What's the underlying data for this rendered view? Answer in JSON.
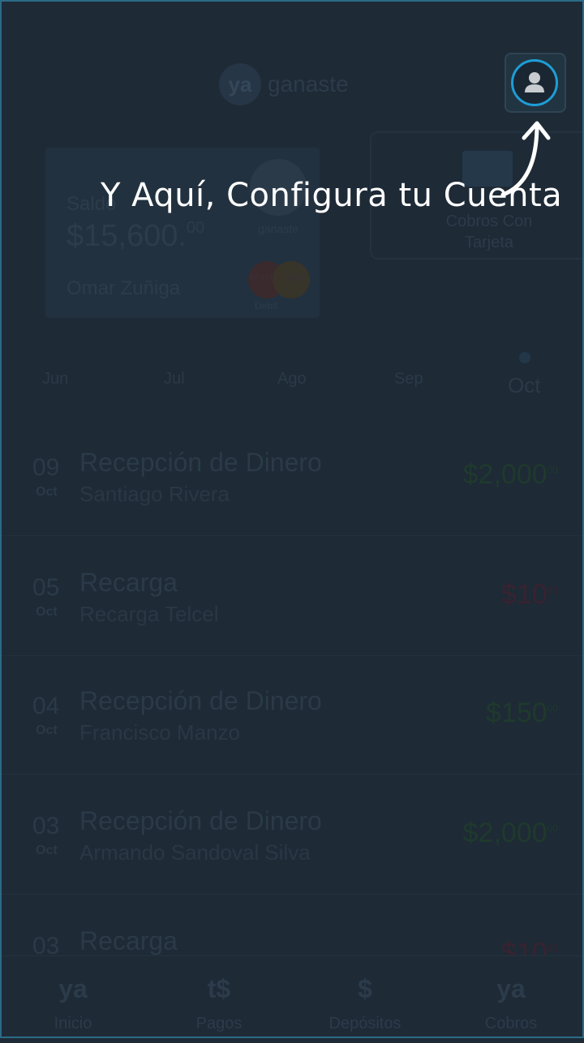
{
  "header": {
    "logo_badge": "ya",
    "logo_text": "ganaste"
  },
  "account_card": {
    "saldo_label": "Saldo",
    "amount": "$15,600.",
    "cents": "00",
    "holder_name": "Omar Zuñiga",
    "brand_text": "ganaste",
    "mastercard_text": "MasterCard",
    "mastercard_sub": "Debit"
  },
  "card_payments": {
    "label": "Cobros Con Tarjeta"
  },
  "months": [
    {
      "label": "Jun"
    },
    {
      "label": "Jul"
    },
    {
      "label": "Ago"
    },
    {
      "label": "Sep"
    },
    {
      "label": "Oct",
      "active": true
    }
  ],
  "transactions": [
    {
      "day": "09",
      "month": "Oct",
      "title": "Recepción de Dinero",
      "subtitle": "Santiago Rivera",
      "amount": "$2,000",
      "cents": "00",
      "type": "in"
    },
    {
      "day": "05",
      "month": "Oct",
      "title": "Recarga",
      "subtitle": "Recarga Telcel",
      "amount": "$10",
      "cents": "00",
      "type": "out"
    },
    {
      "day": "04",
      "month": "Oct",
      "title": "Recepción de Dinero",
      "subtitle": "Francisco Manzo",
      "amount": "$150",
      "cents": "00",
      "type": "in"
    },
    {
      "day": "03",
      "month": "Oct",
      "title": "Recepción de Dinero",
      "subtitle": "Armando Sandoval Silva",
      "amount": "$2,000",
      "cents": "00",
      "type": "in"
    },
    {
      "day": "03",
      "month": "Oct",
      "title": "Recarga",
      "subtitle": "",
      "amount": "$10",
      "cents": "00",
      "type": "out"
    }
  ],
  "bottom_nav": [
    {
      "label": "Inicio",
      "icon": "ya-icon",
      "glyph": "ya"
    },
    {
      "label": "Pagos",
      "icon": "payments-icon",
      "glyph": "t$"
    },
    {
      "label": "Depósitos",
      "icon": "deposit-icon",
      "glyph": "$"
    },
    {
      "label": "Cobros",
      "icon": "collect-icon",
      "glyph": "ya"
    }
  ],
  "tutorial": {
    "annotation": "Y Aquí, Configura tu Cuenta"
  },
  "colors": {
    "accent": "#1e9dd6",
    "overlay": "#1e2a36",
    "income": "#1f3a2c",
    "expense": "#3a2230"
  }
}
